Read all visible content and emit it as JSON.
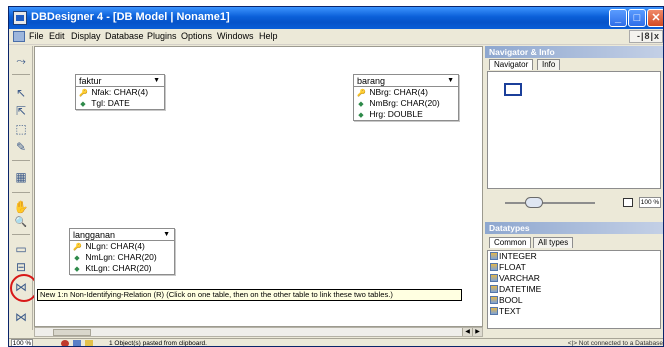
{
  "window": {
    "title": "DBDesigner 4 - [DB Model | Noname1]",
    "minimize_glyph": "_",
    "maximize_glyph": "□",
    "close_glyph": "✕"
  },
  "menu": {
    "items": [
      "File",
      "Edit",
      "Display",
      "Database",
      "Plugins",
      "Options",
      "Windows",
      "Help"
    ],
    "mdi_controls": "-|8|x"
  },
  "toolbar": {
    "tools": [
      {
        "icon": "magic-wand-icon",
        "glyph": "⤳"
      },
      {
        "icon": "pointer-icon",
        "glyph": "↖"
      },
      {
        "icon": "move-pointer-icon",
        "glyph": "⇱"
      },
      {
        "icon": "region-select-icon",
        "glyph": "⬚"
      },
      {
        "icon": "pencil-icon",
        "glyph": "✎"
      },
      {
        "icon": "grid-icon",
        "glyph": "▦"
      },
      {
        "icon": "hand-icon",
        "glyph": "✋"
      },
      {
        "icon": "zoom-icon",
        "glyph": "🔍"
      },
      {
        "icon": "new-table-icon",
        "glyph": "▭"
      },
      {
        "icon": "new-relation-icon",
        "glyph": "⊟"
      },
      {
        "icon": "relation-1n-icon",
        "glyph": "⋈"
      },
      {
        "icon": "relation-nm-icon",
        "glyph": "⋈"
      }
    ]
  },
  "tables": [
    {
      "name": "faktur",
      "columns": [
        {
          "kind": "key",
          "glyph": "🔑",
          "label": "Nfak: CHAR(4)"
        },
        {
          "kind": "attr",
          "glyph": "◆",
          "label": "Tgl: DATE"
        }
      ]
    },
    {
      "name": "barang",
      "columns": [
        {
          "kind": "key",
          "glyph": "🔑",
          "label": "NBrg: CHAR(4)"
        },
        {
          "kind": "attr",
          "glyph": "◆",
          "label": "NmBrg: CHAR(20)"
        },
        {
          "kind": "attr",
          "glyph": "◆",
          "label": "Hrg: DOUBLE"
        }
      ]
    },
    {
      "name": "langganan",
      "columns": [
        {
          "kind": "key",
          "glyph": "🔑",
          "label": "NLgn: CHAR(4)"
        },
        {
          "kind": "attr",
          "glyph": "◆",
          "label": "NmLgn: CHAR(20)"
        },
        {
          "kind": "attr",
          "glyph": "◆",
          "label": "KtLgn: CHAR(20)"
        }
      ]
    }
  ],
  "tooltip": "New 1:n Non-Identifying-Relation (R) (Click on one table, then on the other table to link these two tables.)",
  "navigator": {
    "title": "Navigator & Info",
    "tabs": [
      "Navigator",
      "Info"
    ],
    "zoom_value": "100 %"
  },
  "datatypes": {
    "title": "Datatypes",
    "tabs": [
      "Common",
      "All types"
    ],
    "items": [
      "INTEGER",
      "FLOAT",
      "VARCHAR",
      "DATETIME",
      "BOOL",
      "TEXT"
    ]
  },
  "status": {
    "zoom": "100 %",
    "message": "1 Object(s) pasted from clipboard.",
    "connection": "<|> Not connected to a Database"
  },
  "colors": {
    "titlebar": "#0a5fd8",
    "highlight_ring": "#d81818",
    "tooltip_bg": "#ffffe1"
  }
}
